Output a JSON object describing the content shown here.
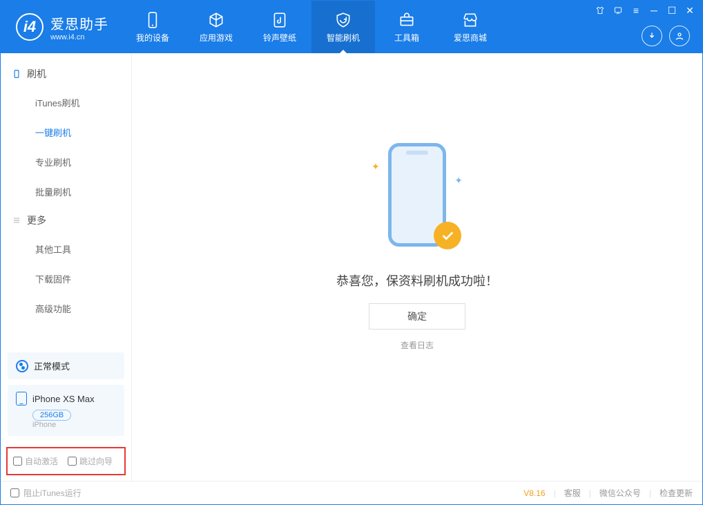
{
  "app": {
    "name_cn": "爱思助手",
    "name_en": "www.i4.cn"
  },
  "nav": {
    "items": [
      {
        "label": "我的设备"
      },
      {
        "label": "应用游戏"
      },
      {
        "label": "铃声壁纸"
      },
      {
        "label": "智能刷机"
      },
      {
        "label": "工具箱"
      },
      {
        "label": "爱思商城"
      }
    ]
  },
  "sidebar": {
    "group1_title": "刷机",
    "group1_items": [
      {
        "label": "iTunes刷机"
      },
      {
        "label": "一键刷机"
      },
      {
        "label": "专业刷机"
      },
      {
        "label": "批量刷机"
      }
    ],
    "group2_title": "更多",
    "group2_items": [
      {
        "label": "其他工具"
      },
      {
        "label": "下载固件"
      },
      {
        "label": "高级功能"
      }
    ]
  },
  "status": {
    "mode": "正常模式"
  },
  "device": {
    "name": "iPhone XS Max",
    "storage": "256GB",
    "type": "iPhone"
  },
  "options": {
    "auto_activate": "自动激活",
    "skip_guide": "跳过向导"
  },
  "main": {
    "success_text": "恭喜您，保资料刷机成功啦！",
    "ok_button": "确定",
    "view_log": "查看日志"
  },
  "footer": {
    "itunes_block": "阻止iTunes运行",
    "version": "V8.16",
    "links": [
      "客服",
      "微信公众号",
      "检查更新"
    ]
  }
}
